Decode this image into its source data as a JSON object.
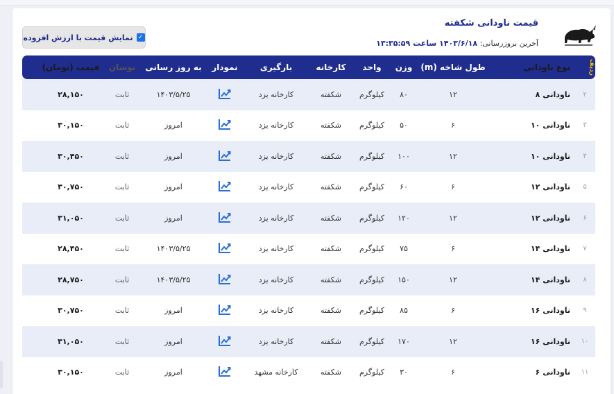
{
  "header": {
    "title": "قیمت ناودانی شکفته",
    "updated_label": "آخرین بروزرسانی:",
    "updated_value": "۱۴۰۳/۶/۱۸ ساعت ۱۳:۳۵:۵۹",
    "logo_icon": "rhino-logo-icon"
  },
  "vat_toggle": {
    "label": "نمایش قیمت با ارزش افزوده",
    "checked": true
  },
  "table": {
    "columns": {
      "idx": "ردیف",
      "type": "نوع ناودانی",
      "length": "طول شاخه (m)",
      "weight": "وزن",
      "unit": "واحد",
      "factory": "کارخانه",
      "loading": "بارگیری",
      "chart": "نمودار",
      "updated": "به روز رسانی",
      "fluct": "نوسان",
      "price": "قیمت (تومان)"
    },
    "rows": [
      {
        "idx": "۲",
        "type": "ناودانی ۸",
        "length": "۱۲",
        "weight": "۸۰",
        "unit": "کیلوگرم",
        "factory": "شکفته",
        "loading": "کارخانه یزد",
        "updated": "۱۴۰۳/۵/۲۵",
        "fluct": "ثابت",
        "price": "۲۸,۱۵۰"
      },
      {
        "idx": "۳",
        "type": "ناودانی ۱۰",
        "length": "۶",
        "weight": "۵۰",
        "unit": "کیلوگرم",
        "factory": "شکفته",
        "loading": "کارخانه یزد",
        "updated": "امروز",
        "fluct": "ثابت",
        "price": "۳۰,۱۵۰"
      },
      {
        "idx": "۴",
        "type": "ناودانی ۱۰",
        "length": "۱۲",
        "weight": "۱۰۰",
        "unit": "کیلوگرم",
        "factory": "شکفته",
        "loading": "کارخانه یزد",
        "updated": "امروز",
        "fluct": "ثابت",
        "price": "۳۰,۴۵۰"
      },
      {
        "idx": "۵",
        "type": "ناودانی ۱۲",
        "length": "۶",
        "weight": "۶۰",
        "unit": "کیلوگرم",
        "factory": "شکفته",
        "loading": "کارخانه یزد",
        "updated": "امروز",
        "fluct": "ثابت",
        "price": "۳۰,۷۵۰"
      },
      {
        "idx": "۶",
        "type": "ناودانی ۱۲",
        "length": "۱۲",
        "weight": "۱۲۰",
        "unit": "کیلوگرم",
        "factory": "شکفته",
        "loading": "کارخانه یزد",
        "updated": "امروز",
        "fluct": "ثابت",
        "price": "۳۱,۰۵۰"
      },
      {
        "idx": "۷",
        "type": "ناودانی ۱۴",
        "length": "۶",
        "weight": "۷۵",
        "unit": "کیلوگرم",
        "factory": "شکفته",
        "loading": "کارخانه یزد",
        "updated": "۱۴۰۳/۵/۲۵",
        "fluct": "ثابت",
        "price": "۲۸,۴۵۰"
      },
      {
        "idx": "۸",
        "type": "ناودانی ۱۴",
        "length": "۱۲",
        "weight": "۱۵۰",
        "unit": "کیلوگرم",
        "factory": "شکفته",
        "loading": "کارخانه یزد",
        "updated": "۱۴۰۳/۵/۲۵",
        "fluct": "ثابت",
        "price": "۲۸,۷۵۰"
      },
      {
        "idx": "۹",
        "type": "ناودانی ۱۶",
        "length": "۶",
        "weight": "۸۵",
        "unit": "کیلوگرم",
        "factory": "شکفته",
        "loading": "کارخانه یزد",
        "updated": "امروز",
        "fluct": "ثابت",
        "price": "۳۰,۷۵۰"
      },
      {
        "idx": "۱۰",
        "type": "ناودانی ۱۶",
        "length": "۱۲",
        "weight": "۱۷۰",
        "unit": "کیلوگرم",
        "factory": "شکفته",
        "loading": "کارخانه یزد",
        "updated": "امروز",
        "fluct": "ثابت",
        "price": "۳۱,۰۵۰"
      },
      {
        "idx": "۱۱",
        "type": "ناودانی ۶",
        "length": "۶",
        "weight": "۳۰",
        "unit": "کیلوگرم",
        "factory": "شکفته",
        "loading": "کارخانه مشهد",
        "updated": "امروز",
        "fluct": "ثابت",
        "price": "۳۰,۱۵۰"
      }
    ],
    "chart_icon": "trend-chart-icon"
  },
  "colors": {
    "primary": "#1f2d8f",
    "row_alt": "#e8edf8",
    "checkbox": "#1a73e8",
    "icon": "#2a6fd6"
  }
}
